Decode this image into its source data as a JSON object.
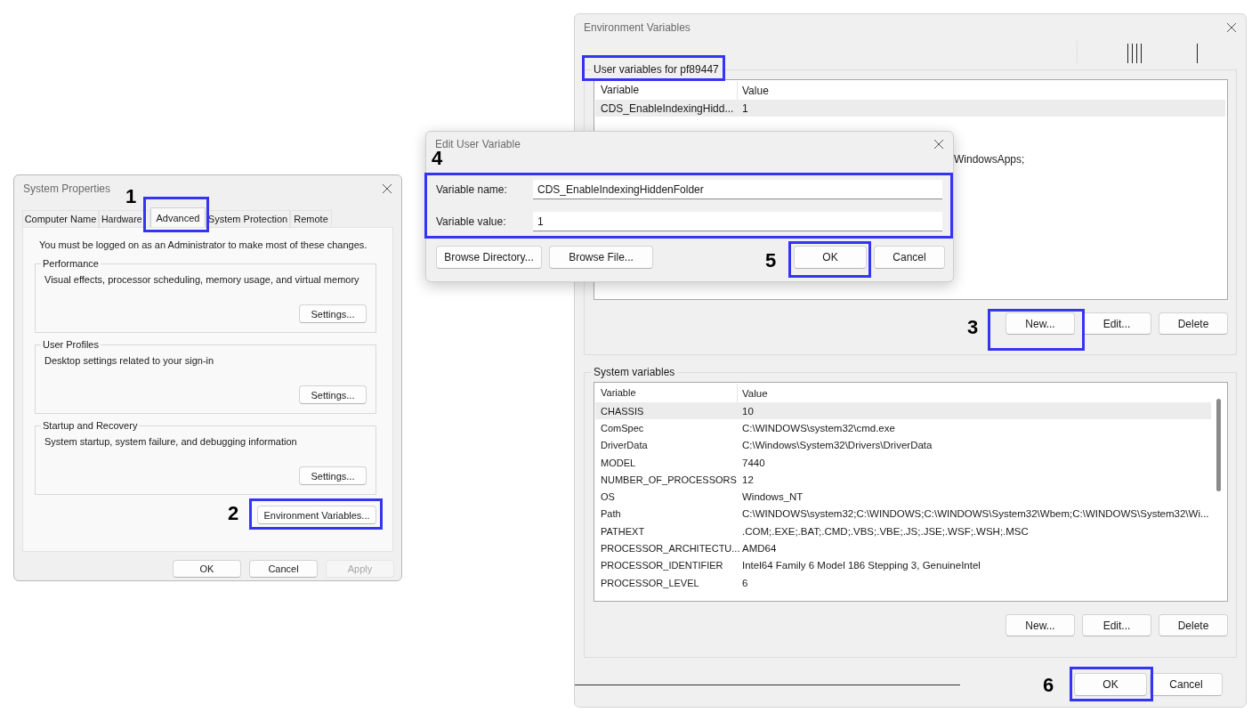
{
  "system_properties": {
    "title": "System Properties",
    "tabs": [
      {
        "label": "Computer Name",
        "selected": false
      },
      {
        "label": "Hardware",
        "selected": false
      },
      {
        "label": "Advanced",
        "selected": true
      },
      {
        "label": "System Protection",
        "selected": false
      },
      {
        "label": "Remote",
        "selected": false
      }
    ],
    "notice": "You must be logged on as an Administrator to make most of these changes.",
    "groups": [
      {
        "title": "Performance",
        "description": "Visual effects, processor scheduling, memory usage, and virtual memory",
        "button": "Settings..."
      },
      {
        "title": "User Profiles",
        "description": "Desktop settings related to your sign-in",
        "button": "Settings..."
      },
      {
        "title": "Startup and Recovery",
        "description": "System startup, system failure, and debugging information",
        "button": "Settings..."
      }
    ],
    "env_button": "Environment Variables...",
    "buttons": [
      {
        "label": "OK",
        "disabled": false
      },
      {
        "label": "Cancel",
        "disabled": false
      },
      {
        "label": "Apply",
        "disabled": true
      }
    ]
  },
  "environment_variables": {
    "title": "Environment Variables",
    "user_section": {
      "title": "User variables for pf89447",
      "columns": [
        "Variable",
        "Value"
      ],
      "rows": [
        {
          "variable": "CDS_EnableIndexingHidd...",
          "value": "1",
          "selected": true
        }
      ],
      "covered_value_tail": "WindowsApps;",
      "buttons": [
        "New...",
        "Edit...",
        "Delete"
      ]
    },
    "system_section": {
      "title": "System variables",
      "columns": [
        "Variable",
        "Value"
      ],
      "rows": [
        {
          "variable": "CHASSIS",
          "value": "10",
          "selected": true
        },
        {
          "variable": "ComSpec",
          "value": "C:\\WINDOWS\\system32\\cmd.exe",
          "selected": false
        },
        {
          "variable": "DriverData",
          "value": "C:\\Windows\\System32\\Drivers\\DriverData",
          "selected": false
        },
        {
          "variable": "MODEL",
          "value": "7440",
          "selected": false
        },
        {
          "variable": "NUMBER_OF_PROCESSORS",
          "value": "12",
          "selected": false
        },
        {
          "variable": "OS",
          "value": "Windows_NT",
          "selected": false
        },
        {
          "variable": "Path",
          "value": "C:\\WINDOWS\\system32;C:\\WINDOWS;C:\\WINDOWS\\System32\\Wbem;C:\\WINDOWS\\System32\\Wi...",
          "selected": false
        },
        {
          "variable": "PATHEXT",
          "value": ".COM;.EXE;.BAT;.CMD;.VBS;.VBE;.JS;.JSE;.WSF;.WSH;.MSC",
          "selected": false
        },
        {
          "variable": "PROCESSOR_ARCHITECTU...",
          "value": "AMD64",
          "selected": false
        },
        {
          "variable": "PROCESSOR_IDENTIFIER",
          "value": "Intel64 Family 6 Model 186 Stepping 3, GenuineIntel",
          "selected": false
        },
        {
          "variable": "PROCESSOR_LEVEL",
          "value": "6",
          "selected": false
        }
      ],
      "buttons": [
        "New...",
        "Edit...",
        "Delete"
      ]
    },
    "buttons": [
      "OK",
      "Cancel"
    ]
  },
  "edit_dialog": {
    "title": "Edit User Variable",
    "fields": [
      {
        "label": "Variable name:",
        "value": "CDS_EnableIndexingHiddenFolder"
      },
      {
        "label": "Variable value:",
        "value": "1"
      }
    ],
    "buttons": [
      "Browse Directory...",
      "Browse File...",
      "OK",
      "Cancel"
    ]
  },
  "annotations": [
    {
      "number": "1"
    },
    {
      "number": "2"
    },
    {
      "number": "3"
    },
    {
      "number": "4"
    },
    {
      "number": "5"
    },
    {
      "number": "6"
    }
  ]
}
